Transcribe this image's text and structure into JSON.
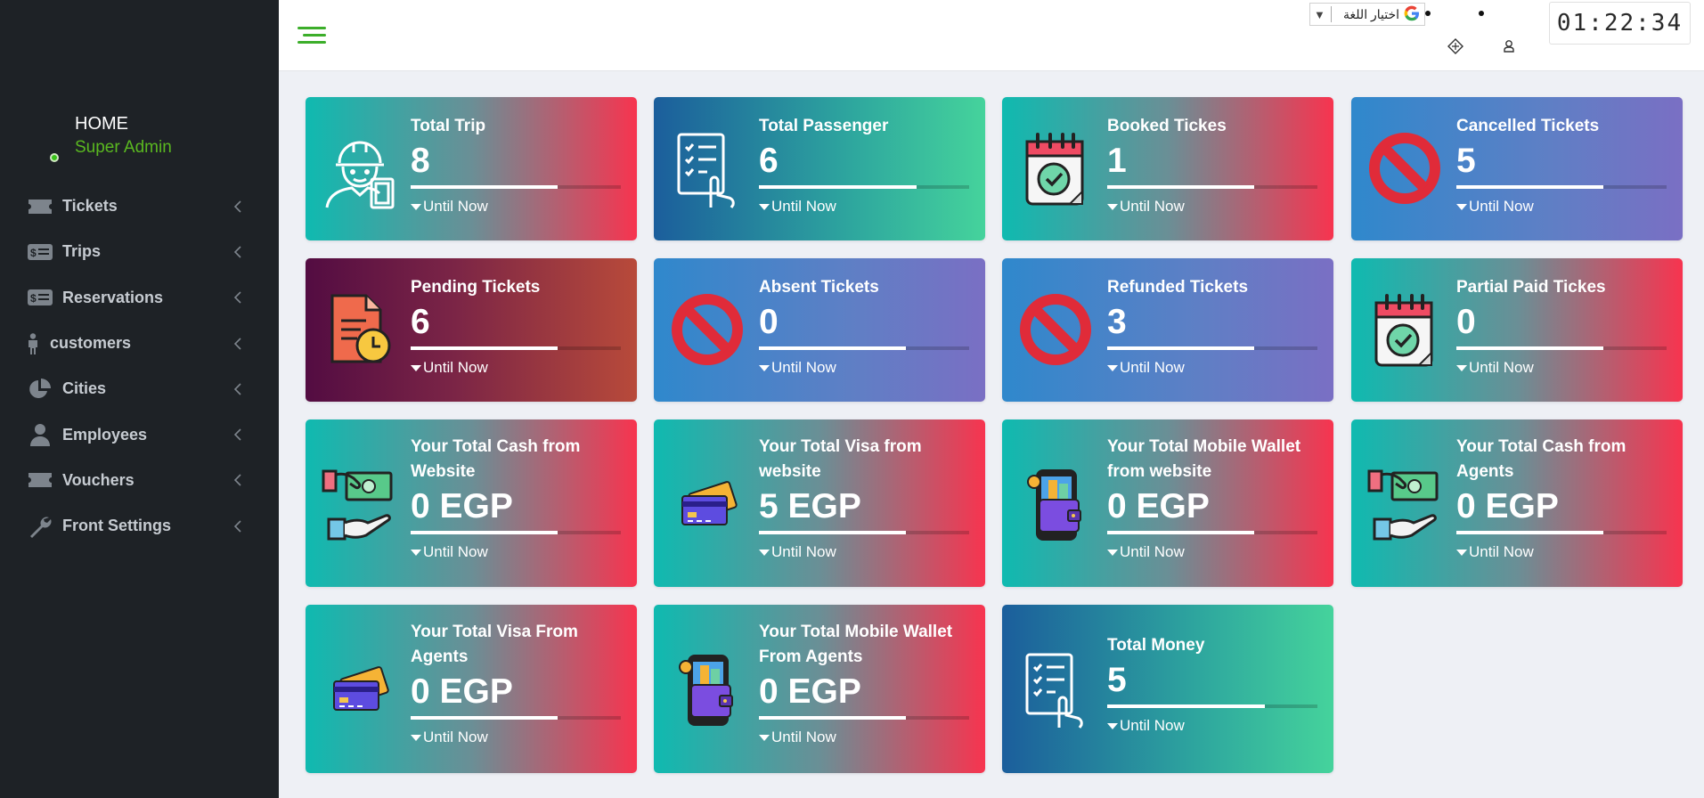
{
  "sidebar": {
    "user": {
      "name": "HOME",
      "role": "Super Admin"
    },
    "items": [
      {
        "label": "Tickets",
        "icon": "ticket-icon"
      },
      {
        "label": "Trips",
        "icon": "money-bill-icon"
      },
      {
        "label": "Reservations",
        "icon": "money-bill-icon"
      },
      {
        "label": "customers",
        "icon": "person-icon"
      },
      {
        "label": "Cities",
        "icon": "pie-chart-icon"
      },
      {
        "label": "Employees",
        "icon": "user-icon"
      },
      {
        "label": "Vouchers",
        "icon": "ticket-icon"
      },
      {
        "label": "Front Settings",
        "icon": "wrench-icon"
      }
    ]
  },
  "header": {
    "language_select": "اختيار اللغة",
    "clock": "01:22:34"
  },
  "cards": [
    {
      "title": "Total Trip",
      "value": "8",
      "footer": "Until Now",
      "progress": 0.7,
      "icon": "worker-icon"
    },
    {
      "title": "Total Passenger",
      "value": "6",
      "footer": "Until Now",
      "progress": 0.75,
      "icon": "checklist-hand-icon"
    },
    {
      "title": "Booked Tickes",
      "value": "1",
      "footer": "Until Now",
      "progress": 0.7,
      "icon": "calendar-check-icon"
    },
    {
      "title": "Cancelled Tickets",
      "value": "5",
      "footer": "Until Now",
      "progress": 0.7,
      "icon": "prohibited-icon"
    },
    {
      "title": "Pending Tickets",
      "value": "6",
      "footer": "Until Now",
      "progress": 0.7,
      "icon": "document-clock-icon"
    },
    {
      "title": "Absent Tickets",
      "value": "0",
      "footer": "Until Now",
      "progress": 0.7,
      "icon": "prohibited-icon"
    },
    {
      "title": "Refunded Tickets",
      "value": "3",
      "footer": "Until Now",
      "progress": 0.7,
      "icon": "prohibited-icon"
    },
    {
      "title": "Partial Paid Tickes",
      "value": "0",
      "footer": "Until Now",
      "progress": 0.7,
      "icon": "calendar-check-icon"
    },
    {
      "title": "Your Total Cash from Website",
      "value": "0 EGP",
      "footer": "Until Now",
      "progress": 0.7,
      "icon": "cash-hand-icon"
    },
    {
      "title": "Your Total Visa from website",
      "value": "5 EGP",
      "footer": "Until Now",
      "progress": 0.7,
      "icon": "credit-card-icon"
    },
    {
      "title": "Your Total Mobile Wallet from website",
      "value": "0 EGP",
      "footer": "Until Now",
      "progress": 0.7,
      "icon": "mobile-wallet-icon"
    },
    {
      "title": "Your Total Cash from Agents",
      "value": "0 EGP",
      "footer": "Until Now",
      "progress": 0.7,
      "icon": "cash-hand-icon"
    },
    {
      "title": "Your Total Visa From Agents",
      "value": "0 EGP",
      "footer": "Until Now",
      "progress": 0.7,
      "icon": "credit-card-icon"
    },
    {
      "title": "Your Total Mobile Wallet From Agents",
      "value": "0 EGP",
      "footer": "Until Now",
      "progress": 0.7,
      "icon": "mobile-wallet-icon"
    },
    {
      "title": "Total Money",
      "value": "5",
      "footer": "Until Now",
      "progress": 0.75,
      "icon": "checklist-hand-icon"
    }
  ]
}
